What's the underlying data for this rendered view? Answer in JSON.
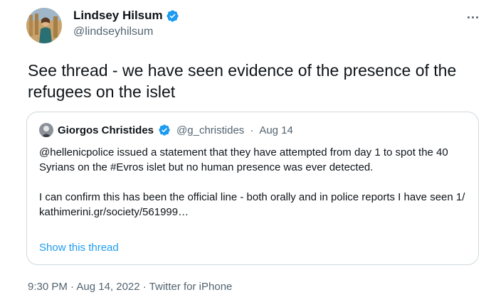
{
  "author": {
    "display_name": "Lindsey Hilsum",
    "handle": "@lindseyhilsum",
    "verified": true
  },
  "tweet": {
    "text": "See thread - we have seen evidence of the presence of the refugees on the islet",
    "timestamp": "9:30 PM · Aug 14, 2022 · Twitter for iPhone"
  },
  "quoted": {
    "display_name": "Giorgos Christides",
    "handle": "@g_christides",
    "separator": "·",
    "date": "Aug 14",
    "para1": "@hellenicpolice issued a statement that they have attempted from day 1 to spot the 40 Syrians on the #Evros islet but no human presence was ever detected.",
    "para2": "I can confirm this has been the official line - both orally and in police reports I have seen 1/",
    "link": "kathimerini.gr/society/561999…",
    "show_thread": "Show this thread"
  },
  "icons": {
    "verified": "verified-badge-icon",
    "more": "more-options-icon"
  },
  "colors": {
    "accent": "#1d9bf0",
    "secondary_text": "#536471",
    "border": "#cfd9de"
  }
}
